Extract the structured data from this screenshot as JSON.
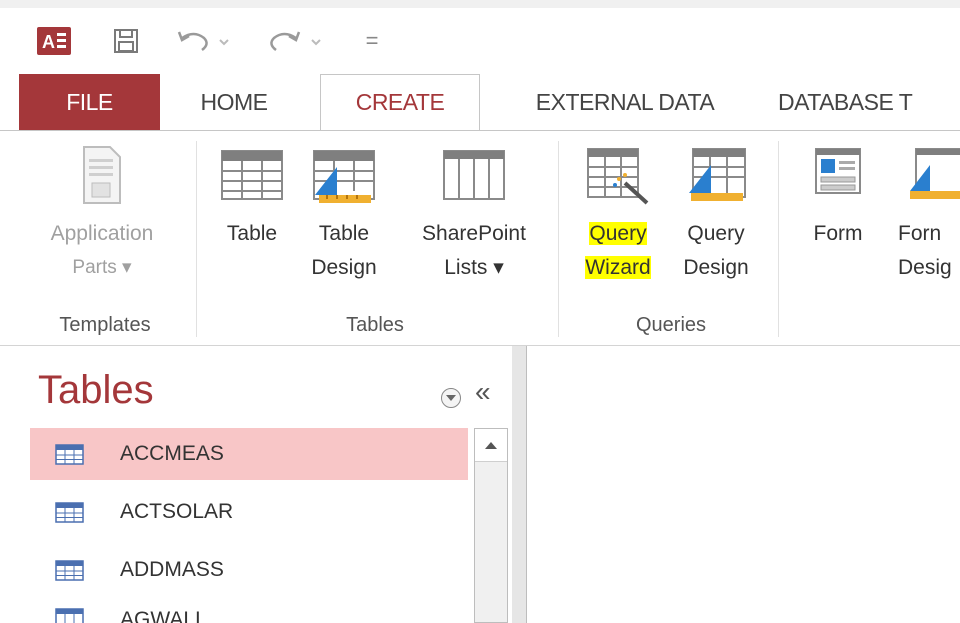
{
  "qat": {
    "app_icon_text": "A3",
    "customize_glyph": "="
  },
  "tabs": [
    {
      "label": "FILE"
    },
    {
      "label": "HOME"
    },
    {
      "label": "CREATE"
    },
    {
      "label": "EXTERNAL DATA"
    },
    {
      "label": "DATABASE T"
    }
  ],
  "ribbon": {
    "templates": {
      "app_parts": {
        "line1": "Application",
        "line2": "Parts ▾"
      },
      "group_label": "Templates"
    },
    "tables": {
      "table": {
        "line1": "Table"
      },
      "table_design": {
        "line1": "Table",
        "line2": "Design"
      },
      "sharepoint": {
        "line1": "SharePoint",
        "line2": "Lists ▾"
      },
      "group_label": "Tables"
    },
    "queries": {
      "query_wizard": {
        "line1": "Query",
        "line2": "Wizard"
      },
      "query_design": {
        "line1": "Query",
        "line2": "Design"
      },
      "group_label": "Queries"
    },
    "forms": {
      "form": {
        "line1": "Form"
      },
      "form_design": {
        "line1": "Forn",
        "line2": "Desig"
      }
    }
  },
  "nav": {
    "title": "Tables",
    "collapse_glyph": "«",
    "items": [
      {
        "label": "ACCMEAS"
      },
      {
        "label": "ACTSOLAR"
      },
      {
        "label": "ADDMASS"
      },
      {
        "label": "AGWALL"
      }
    ]
  },
  "colors": {
    "accent": "#a4373a",
    "selected_row": "#f8c6c7",
    "highlight": "#ffff00"
  }
}
